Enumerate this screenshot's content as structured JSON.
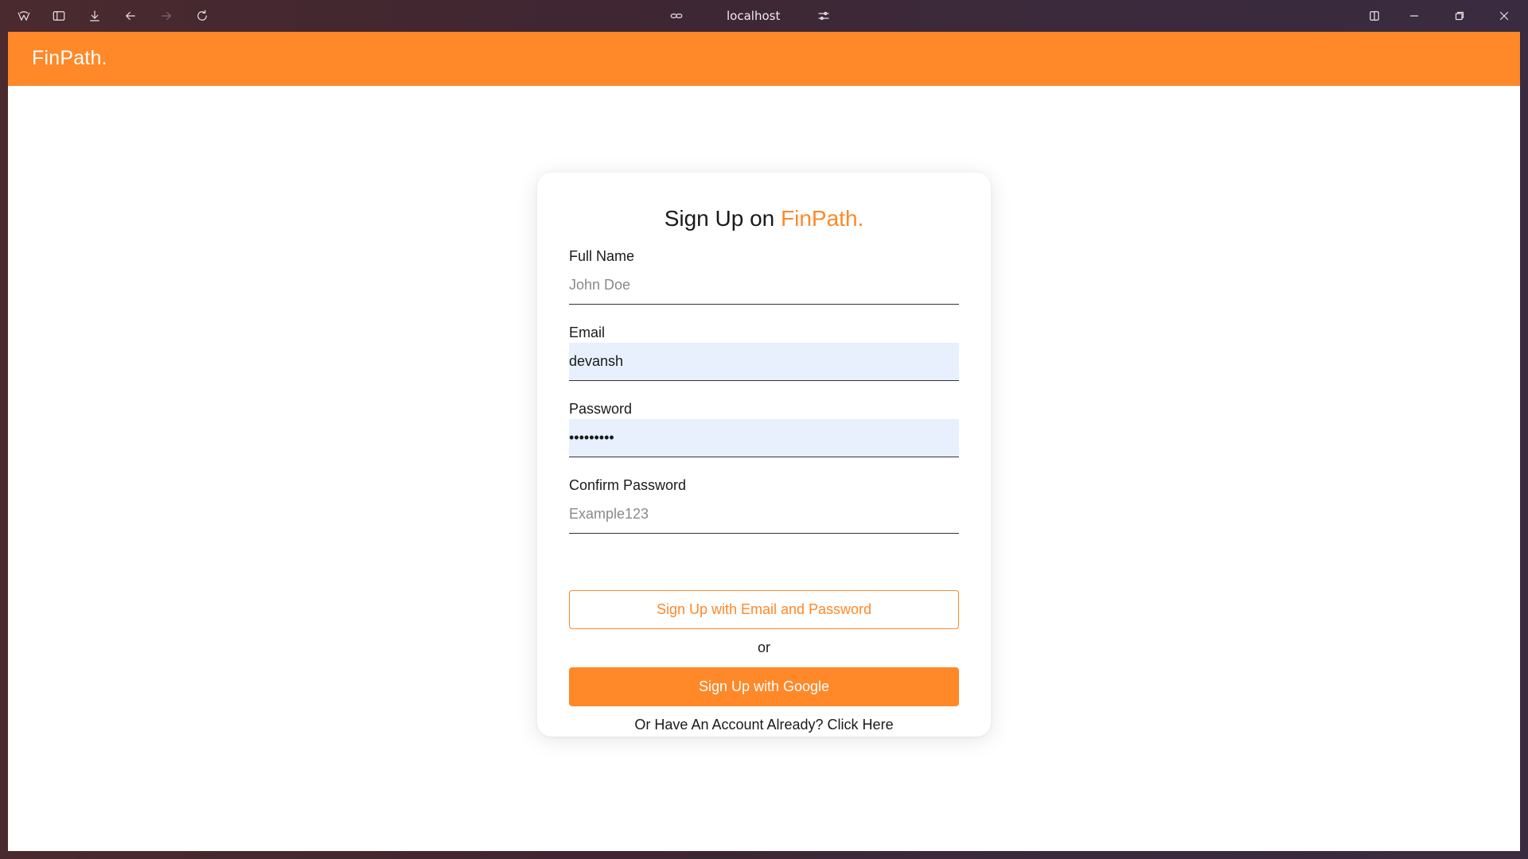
{
  "browser": {
    "address": "localhost",
    "icons": [
      "browser-logo-icon",
      "sidebar-toggle-icon",
      "download-icon",
      "back-arrow-icon",
      "forward-arrow-icon",
      "reload-icon",
      "link-icon",
      "site-settings-icon",
      "split-view-icon",
      "minimize-icon",
      "restore-icon",
      "close-icon"
    ]
  },
  "navbar": {
    "brand": "FinPath."
  },
  "card": {
    "title_prefix": "Sign Up on ",
    "title_accent": "FinPath.",
    "fields": {
      "full_name": {
        "label": "Full Name",
        "placeholder": "John Doe",
        "value": ""
      },
      "email": {
        "label": "Email",
        "placeholder": "",
        "value": "devansh"
      },
      "password": {
        "label": "Password",
        "placeholder": "",
        "value": "•••••••••"
      },
      "confirm_password": {
        "label": "Confirm Password",
        "placeholder": "Example123",
        "value": ""
      }
    },
    "email_button": "Sign Up with Email and Password",
    "or_text": "or",
    "google_button": "Sign Up with Google",
    "login_link": "Or Have An Account Already? Click Here"
  },
  "colors": {
    "accent": "#ff8828",
    "autofill": "#e8f0fe"
  }
}
